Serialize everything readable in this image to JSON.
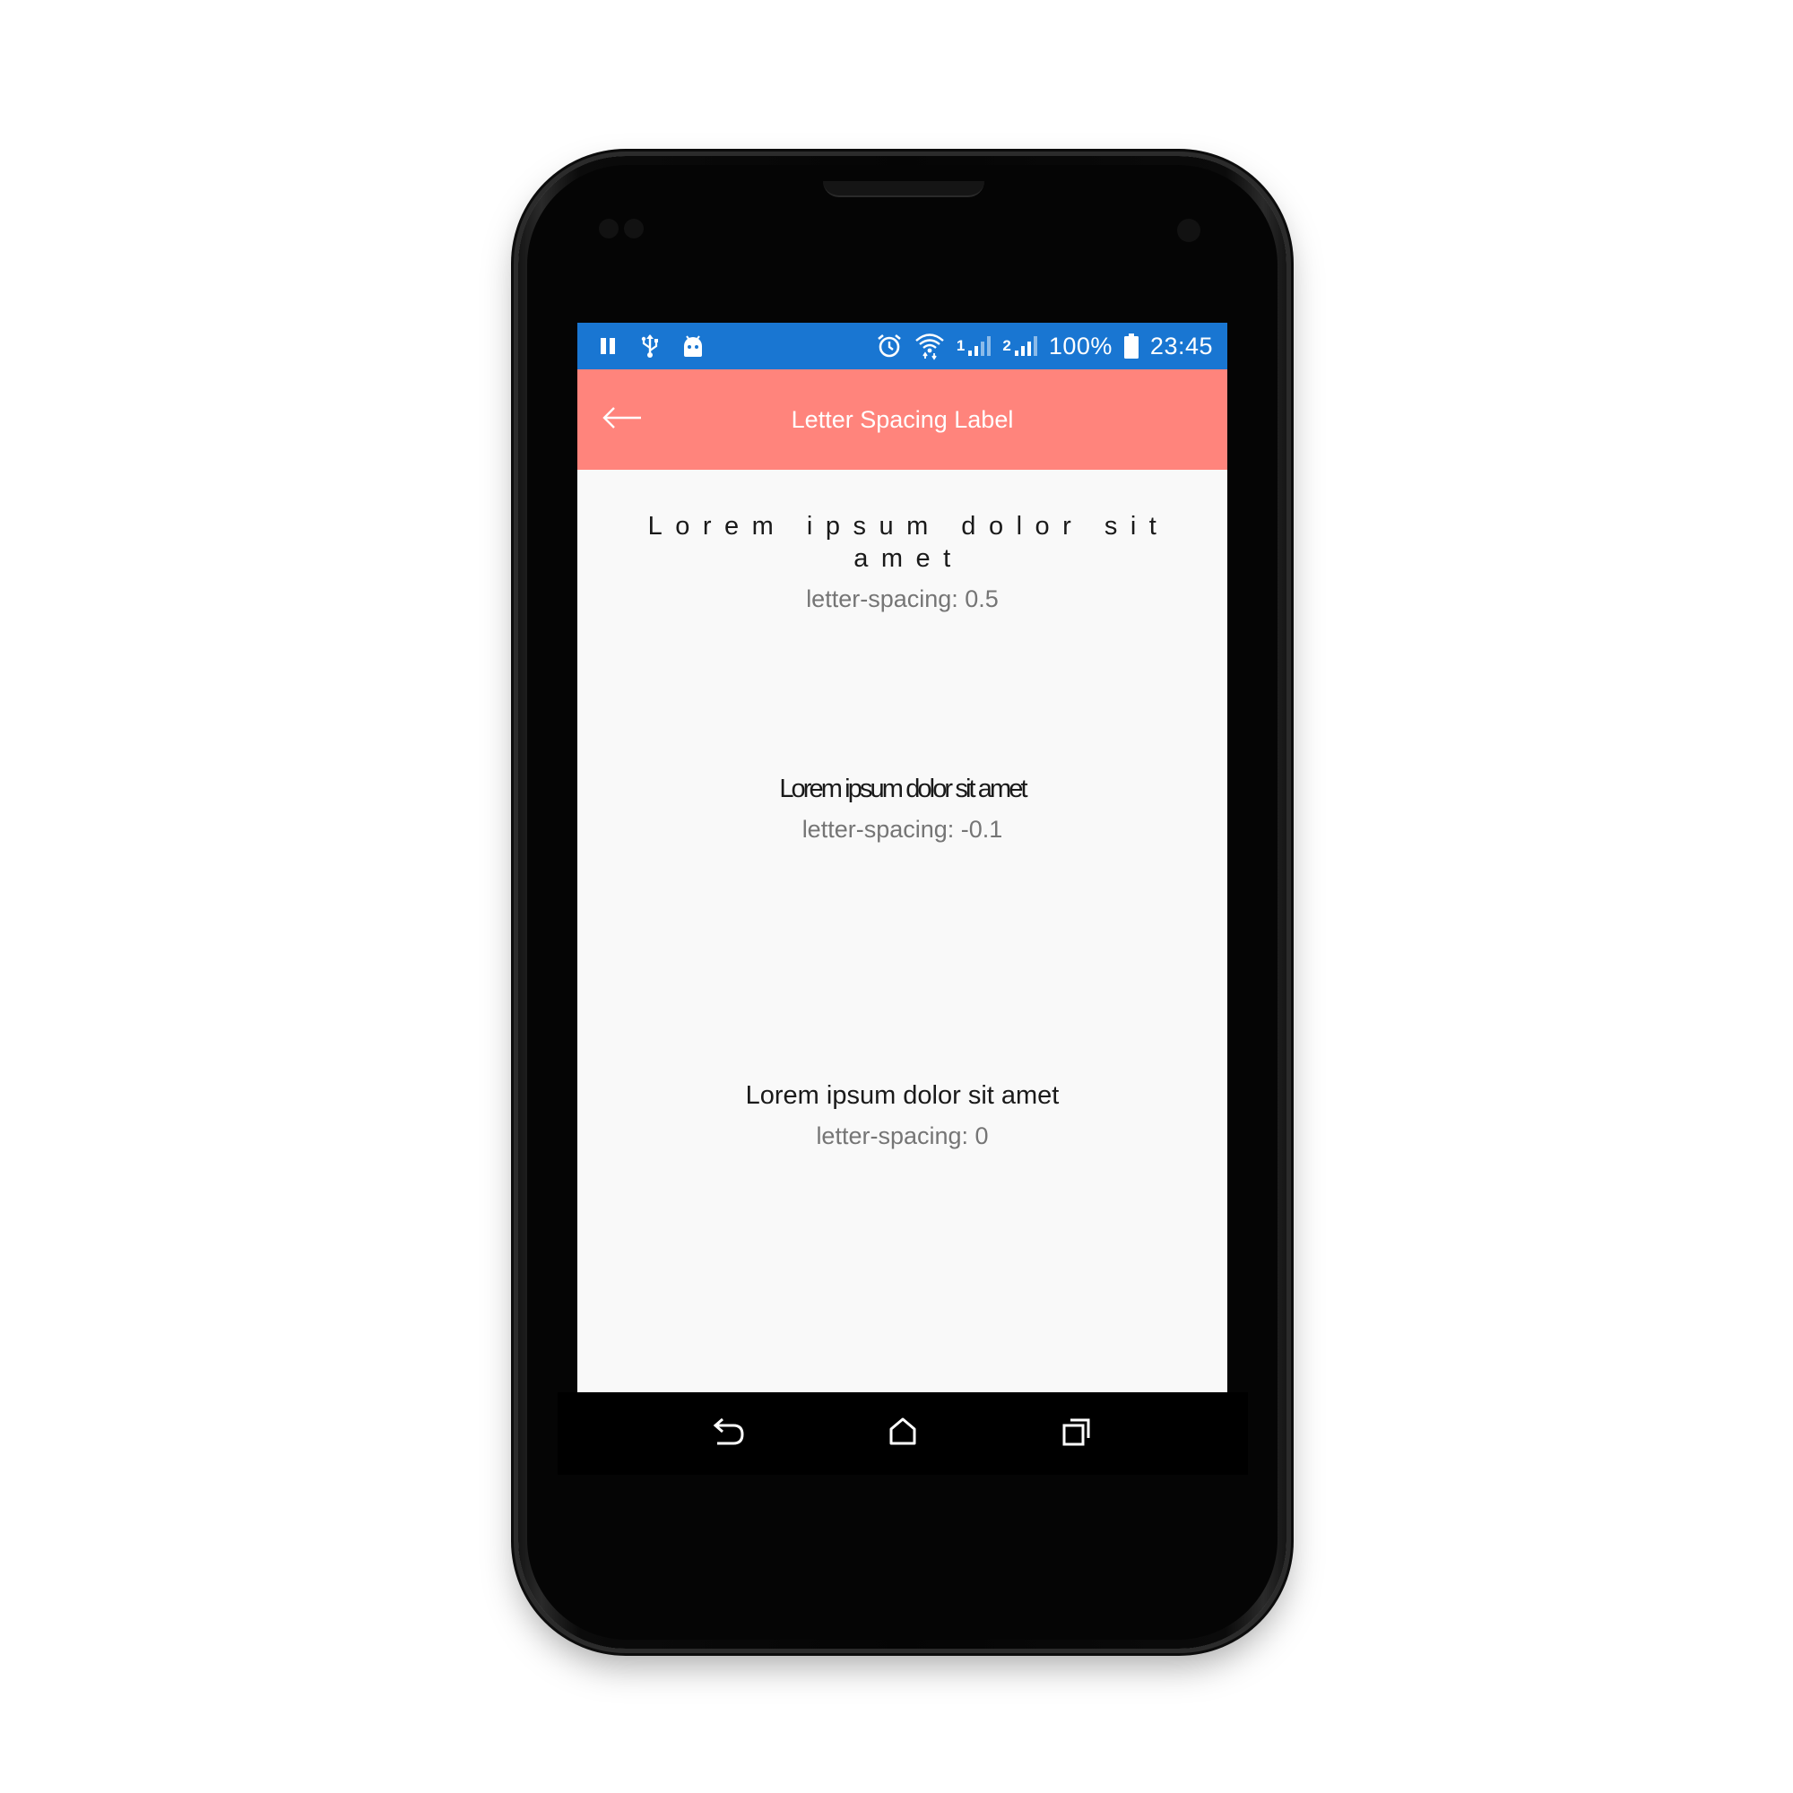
{
  "colors": {
    "status_bar": "#1976D2",
    "app_bar": "#FF847C",
    "content_bg": "#F9F9F9",
    "sample_text": "#1A1A1A",
    "caption_text": "#757575"
  },
  "status_bar": {
    "left_icons": [
      "pause-icon",
      "usb-icon",
      "android-debug-icon"
    ],
    "right_icons": [
      "alarm-icon",
      "wifi-icon",
      "signal-sim1-icon",
      "signal-sim2-icon",
      "battery-icon"
    ],
    "sim1_label": "1",
    "sim2_label": "2",
    "battery_percent": "100%",
    "time": "23:45"
  },
  "app_bar": {
    "title": "Letter Spacing Label",
    "back_icon": "arrow-back-icon"
  },
  "samples": [
    {
      "text": "Lorem ipsum dolor sit amet",
      "caption": "letter-spacing: 0.5"
    },
    {
      "text": "Lorem ipsum dolor sit amet",
      "caption": "letter-spacing: -0.1"
    },
    {
      "text": "Lorem ipsum dolor sit amet",
      "caption": "letter-spacing: 0"
    }
  ],
  "nav_bar": {
    "icons": [
      "back-nav-icon",
      "home-icon",
      "recents-icon"
    ]
  }
}
